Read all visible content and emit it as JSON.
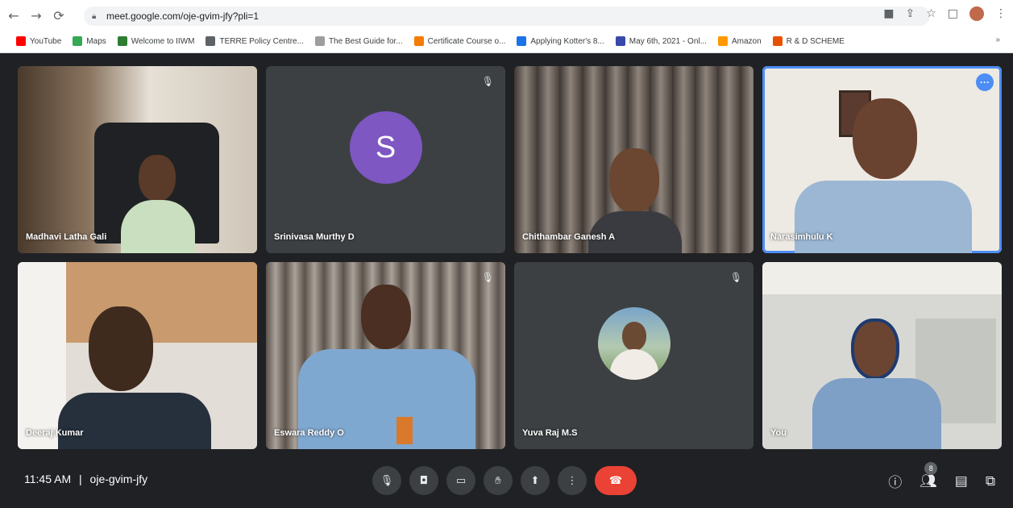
{
  "browser": {
    "url": "meet.google.com/oje-gvim-jfy?pli=1",
    "bookmarks": [
      {
        "label": "YouTube",
        "color": "#ff0000"
      },
      {
        "label": "Maps",
        "color": "#34a853"
      },
      {
        "label": "Welcome to IIWM",
        "color": "#2e7d32"
      },
      {
        "label": "TERRE Policy Centre...",
        "color": "#5f6368"
      },
      {
        "label": "The Best Guide for...",
        "color": "#9e9e9e"
      },
      {
        "label": "Certificate Course o...",
        "color": "#f57c00"
      },
      {
        "label": "Applying Kotter's 8...",
        "color": "#1a73e8"
      },
      {
        "label": "May 6th, 2021 - Onl...",
        "color": "#3949ab"
      },
      {
        "label": "Amazon",
        "color": "#ff9900"
      },
      {
        "label": "R & D SCHEME",
        "color": "#e65100"
      }
    ],
    "more_bookmarks": "»"
  },
  "participants": [
    {
      "name": "Madhavi Latha Gali",
      "muted": false,
      "type": "video"
    },
    {
      "name": "Srinivasa Murthy D",
      "muted": true,
      "type": "initial",
      "initial": "S"
    },
    {
      "name": "Chithambar Ganesh A",
      "muted": false,
      "type": "video"
    },
    {
      "name": "Narasimhulu K",
      "muted": false,
      "type": "video",
      "active_speaker": true
    },
    {
      "name": "Deeraj Kumar",
      "muted": false,
      "type": "video"
    },
    {
      "name": "Eswara Reddy O",
      "muted": true,
      "type": "video"
    },
    {
      "name": "Yuva Raj M.S",
      "muted": true,
      "type": "photo"
    },
    {
      "name": "You",
      "muted": false,
      "type": "video"
    }
  ],
  "meeting": {
    "time": "11:45 AM",
    "separator": "|",
    "code": "oje-gvim-jfy",
    "people_count": "8"
  },
  "colors": {
    "accent": "#4c8df6",
    "end_call": "#ea4335",
    "background": "#202124"
  }
}
